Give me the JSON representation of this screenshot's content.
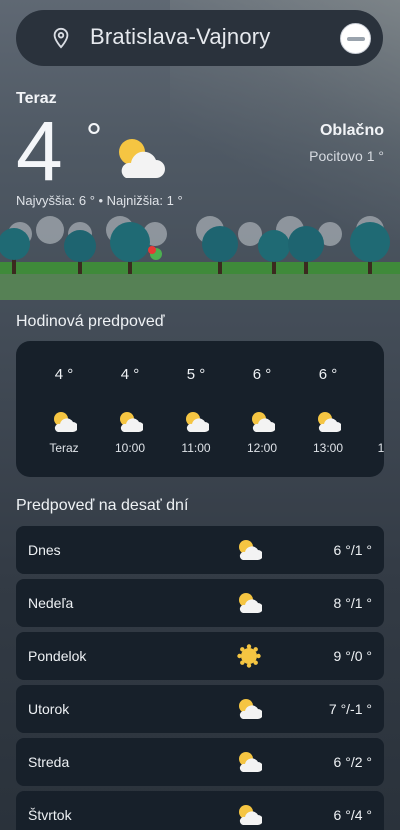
{
  "search": {
    "location": "Bratislava-Vajnory"
  },
  "current": {
    "label": "Teraz",
    "temp": "4",
    "deg": "°",
    "condition": "Oblačno",
    "feels_like": "Pocitovo 1 °",
    "hilo": "Najvyššia: 6 ° • Najnižšia: 1 °",
    "icon": "partly-cloudy-icon"
  },
  "hourly": {
    "title": "Hodinová predpoveď",
    "items": [
      {
        "temp": "4 °",
        "time": "Teraz",
        "icon": "partly-cloudy-icon"
      },
      {
        "temp": "4 °",
        "time": "10:00",
        "icon": "partly-cloudy-icon"
      },
      {
        "temp": "5 °",
        "time": "11:00",
        "icon": "partly-cloudy-icon"
      },
      {
        "temp": "6 °",
        "time": "12:00",
        "icon": "partly-cloudy-icon"
      },
      {
        "temp": "6 °",
        "time": "13:00",
        "icon": "partly-cloudy-icon"
      },
      {
        "temp": "",
        "time": "1",
        "icon": ""
      }
    ]
  },
  "daily": {
    "title": "Predpoveď na desať dní",
    "items": [
      {
        "day": "Dnes",
        "range": "6 °/1 °",
        "icon": "partly-cloudy-icon"
      },
      {
        "day": "Nedeľa",
        "range": "8 °/1 °",
        "icon": "partly-cloudy-icon"
      },
      {
        "day": "Pondelok",
        "range": "9 °/0 °",
        "icon": "sun-icon"
      },
      {
        "day": "Utorok",
        "range": "7 °/-1 °",
        "icon": "partly-cloudy-icon"
      },
      {
        "day": "Streda",
        "range": "6 °/2 °",
        "icon": "partly-cloudy-icon"
      },
      {
        "day": "Štvrtok",
        "range": "6 °/4 °",
        "icon": "partly-cloudy-icon"
      }
    ]
  },
  "colors": {
    "card": "#17202a",
    "sun": "#f5c542",
    "cloud": "#f4f4f4"
  }
}
